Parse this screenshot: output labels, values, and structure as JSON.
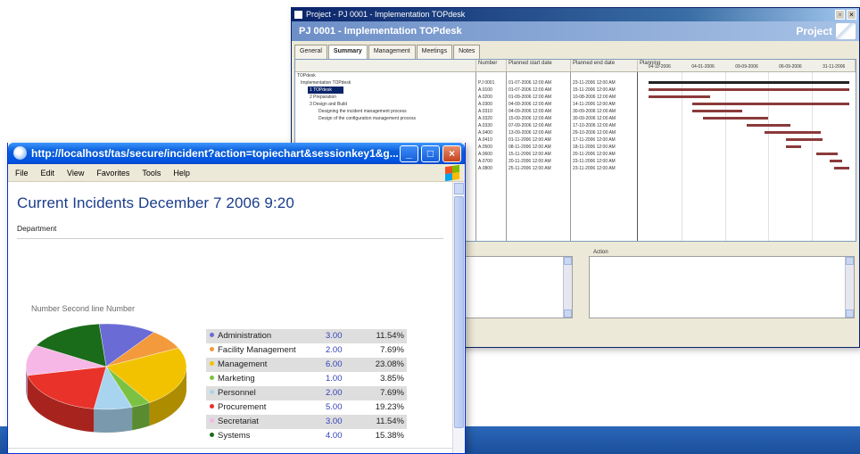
{
  "project_window": {
    "title": "Project - PJ 0001 - Implementation TOPdesk",
    "header_title": "PJ 0001 - Implementation TOPdesk",
    "header_right": "Project",
    "tabs": [
      "General",
      "Summary",
      "Management",
      "Meetings",
      "Notes"
    ],
    "active_tab": 1,
    "columns": [
      "",
      "Number",
      "Planned start date",
      "Planned end date",
      "Planning"
    ],
    "gantt_dates": [
      "04-11-2006",
      "04-01-2006",
      "09-09-2006",
      "06-09-2006",
      "31-11-2006"
    ],
    "tree_rows": [
      "TOPdesk",
      "Implementation TOPdesk",
      "1 TOPdesk",
      "2 Preparation",
      "3 Design and Build",
      "Designing the incident management process",
      "Design of the configuration management process",
      "",
      "",
      "",
      "",
      "",
      "",
      ""
    ],
    "numbers": [
      "",
      "PJ 0001",
      "A.0100",
      "A.0200",
      "A.0300",
      "A.0310",
      "A.0320",
      "A.0330",
      "A.0400",
      "A.0410",
      "A.0500",
      "A.0600",
      "A.0700",
      "A.0800"
    ],
    "start_dates": [
      "",
      "01-07-2006 12:00 AM",
      "01-07-2006 12:00 AM",
      "01-09-2006 12:00 AM",
      "04-09-2006 12:00 AM",
      "04-09-2006 12:00 AM",
      "15-09-2006 12:00 AM",
      "07-09-2006 12:00 AM",
      "13-09-2006 12:00 AM",
      "01-11-2006 12:00 AM",
      "08-11-2006 12:00 AM",
      "15-11-2006 12:00 AM",
      "20-11-2006 12:00 AM",
      "25-11-2006 12:00 AM"
    ],
    "end_dates": [
      "",
      "23-11-2006 12:00 AM",
      "15-11-2006 12:00 AM",
      "10-08-2006 12:00 AM",
      "14-11-2006 12:00 AM",
      "30-09-2006 12:00 AM",
      "30-09-2006 12:00 AM",
      "17-10-2006 12:00 AM",
      "29-10-2006 12:00 AM",
      "17-11-2006 12:00 AM",
      "18-11-2006 12:00 AM",
      "20-11-2006 12:00 AM",
      "23-11-2006 12:00 AM",
      "23-11-2006 12:00 AM"
    ],
    "panels": [
      "",
      "Action"
    ]
  },
  "ie_window": {
    "title": "http://localhost/tas/secure/incident?action=topiechart&sessionkey1&g...",
    "menu": [
      "File",
      "Edit",
      "View",
      "Favorites",
      "Tools",
      "Help"
    ]
  },
  "page": {
    "title": "Current Incidents December 7 2006 9:20",
    "department_label": "Department"
  },
  "chart_data": {
    "type": "pie",
    "title": "Number Second line Number",
    "categories": [
      "Administration",
      "Facility Management",
      "Management",
      "Marketing",
      "Personnel",
      "Procurement",
      "Secretariat",
      "Systems"
    ],
    "values": [
      3,
      2,
      6,
      1,
      2,
      5,
      3,
      4
    ],
    "value_labels": [
      "3.00",
      "2.00",
      "6.00",
      "1.00",
      "2.00",
      "5.00",
      "3.00",
      "4.00"
    ],
    "percentages": [
      "11.54%",
      "7.69%",
      "23.08%",
      "3.85%",
      "7.69%",
      "19.23%",
      "11.54%",
      "15.38%"
    ],
    "colors": [
      "#6b6bd6",
      "#f39a3c",
      "#f2c200",
      "#7cc242",
      "#a9d4ef",
      "#e8322a",
      "#f7b7e6",
      "#1a6b1a"
    ]
  }
}
